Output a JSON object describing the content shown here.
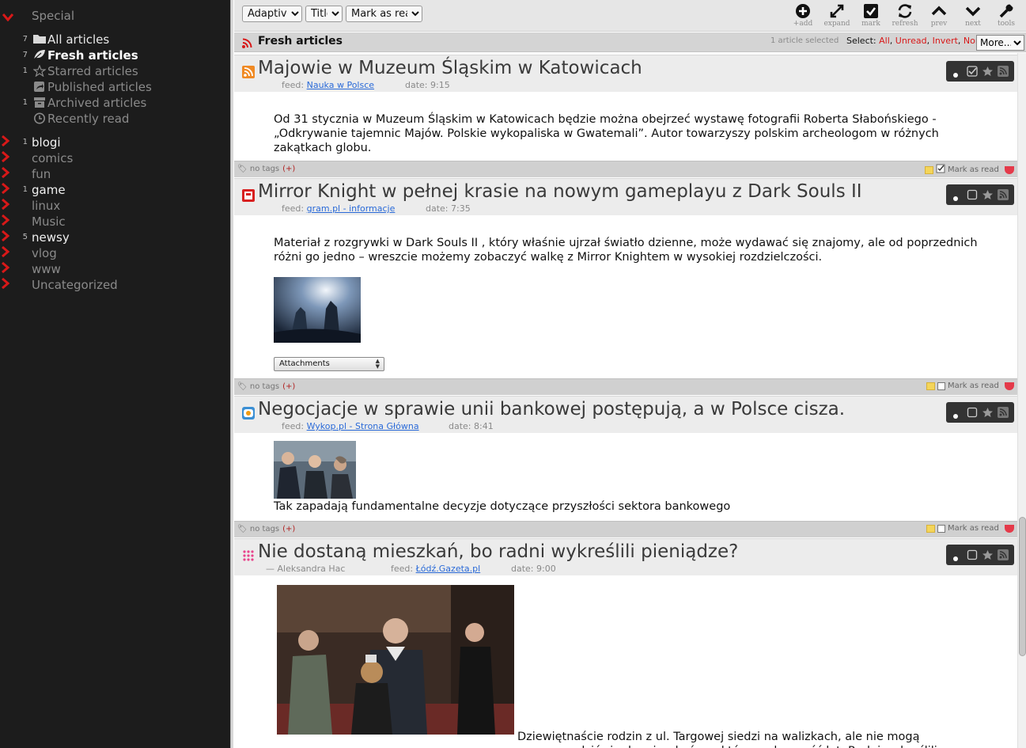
{
  "sidebar": {
    "special_label": "Special",
    "feeds": [
      {
        "count": "7",
        "label": "All articles",
        "icon": "folder-icon"
      },
      {
        "count": "7",
        "label": "Fresh articles",
        "icon": "leaf-icon"
      },
      {
        "count": "1",
        "label": "Starred articles",
        "icon": "star-icon"
      },
      {
        "count": "",
        "label": "Published articles",
        "icon": "share-icon"
      },
      {
        "count": "1",
        "label": "Archived articles",
        "icon": "archive-icon"
      },
      {
        "count": "",
        "label": "Recently read",
        "icon": "clock-icon"
      }
    ],
    "categories": [
      {
        "count": "1",
        "label": "blogi"
      },
      {
        "count": "",
        "label": "comics"
      },
      {
        "count": "",
        "label": "fun"
      },
      {
        "count": "1",
        "label": "game"
      },
      {
        "count": "",
        "label": "linux"
      },
      {
        "count": "",
        "label": "Music"
      },
      {
        "count": "5",
        "label": "newsy"
      },
      {
        "count": "",
        "label": "vlog"
      },
      {
        "count": "",
        "label": "www"
      },
      {
        "count": "",
        "label": "Uncategorized"
      }
    ]
  },
  "toolbar": {
    "view_mode": "Adaptive",
    "order_by": "Title",
    "action": "Mark as read",
    "buttons": {
      "add": "+add",
      "expand": "expand",
      "mark": "mark",
      "refresh": "refresh",
      "prev": "prev",
      "next": "next",
      "tools": "tools"
    }
  },
  "headlines": {
    "title": "Fresh articles",
    "selected_info": "1 article selected",
    "select_label": "Select:",
    "select_all": "All",
    "select_unread": "Unread",
    "select_invert": "Invert",
    "select_none": "None",
    "more_label": "More..."
  },
  "common": {
    "feed_label": "feed:",
    "date_label": "date:",
    "no_tags": "no tags",
    "plus": "(+)",
    "mark_as_read": "Mark as read",
    "attachments": "Attachments"
  },
  "articles": [
    {
      "title": "Majowie w Muzeum Śląskim w Katowicach",
      "feed": "Nauka w Polsce",
      "date": "9:15",
      "author": "",
      "body": "Od 31 stycznia w Muzeum Śląskim w Katowicach będzie można obejrzeć wystawę fotografii Roberta Słabońskiego - „Odkrywanie tajemnic Majów. Polskie wykopaliska w Gwatemali”. Autor towarzyszy polskim archeologom w różnych zakątkach globu."
    },
    {
      "title": "Mirror Knight w pełnej krasie na nowym gameplayu z Dark Souls II",
      "feed": "gram.pl - informacje",
      "date": "7:35",
      "author": "",
      "body": "Materiał z rozgrywki w Dark Souls II , który właśnie ujrzał światło dzienne, może wydawać się znajomy, ale od poprzednich różni go jedno – wreszcie możemy zobaczyć walkę z Mirror Knightem w wysokiej rozdzielczości."
    },
    {
      "title": "Negocjacje w sprawie unii bankowej postępują, a w Polsce cisza.",
      "feed": "Wykop.pl - Strona Główna",
      "date": "8:41",
      "author": "",
      "body": "Tak zapadają fundamentalne decyzje dotyczące przyszłości sektora bankowego"
    },
    {
      "title": "Nie dostaną mieszkań, bo radni wykreślili pieniądze?",
      "feed": "Łódź.Gazeta.pl",
      "date": "9:00",
      "author": "— Aleksandra Hac",
      "body": "Dziewiętnaście rodzin z ul. Targowej siedzi na walizkach, ale nie mogą przeprowadzić się do mieszkań, na które czeka sześć lat. Radni wykreślili z budżetu budowę ul. Nowotargowej, a to - zdaniem władz miasta"
    }
  ],
  "colors": {
    "sidebar_bg": "#1c1c1c",
    "accent_red": "#d81818",
    "link_blue": "#2a6ad8"
  }
}
